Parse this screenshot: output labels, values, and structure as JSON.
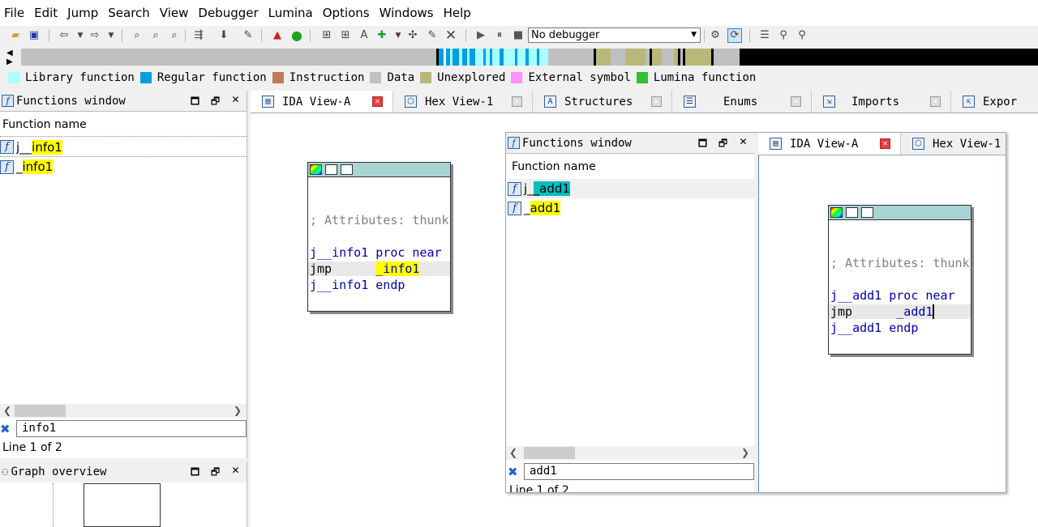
{
  "menu": [
    "File",
    "Edit",
    "Jump",
    "Search",
    "View",
    "Debugger",
    "Lumina",
    "Options",
    "Windows",
    "Help"
  ],
  "toolbar": {
    "debugger_select": "No debugger"
  },
  "legend": [
    {
      "label": "Library function",
      "color": "#aaffff"
    },
    {
      "label": "Regular function",
      "color": "#00a0e0"
    },
    {
      "label": "Instruction",
      "color": "#c07858"
    },
    {
      "label": "Data",
      "color": "#c0c0c0"
    },
    {
      "label": "Unexplored",
      "color": "#b8b878"
    },
    {
      "label": "External symbol",
      "color": "#ff90ff"
    },
    {
      "label": "Lumina function",
      "color": "#30c030"
    }
  ],
  "left_functions": {
    "title": "Functions window",
    "column": "Function name",
    "rows": [
      {
        "prefix": "j__",
        "hl": "info1"
      },
      {
        "prefix": "_",
        "hl": "info1"
      }
    ],
    "filter": "info1",
    "status": "Line 1 of 2"
  },
  "graph_overview": {
    "title": "Graph overview"
  },
  "tabs": [
    {
      "label": "IDA View-A",
      "icon": "ida-view-icon"
    },
    {
      "label": "Hex View-1",
      "icon": "hex-view-icon"
    },
    {
      "label": "Structures",
      "icon": "structures-icon"
    },
    {
      "label": "Enums",
      "icon": "enums-icon"
    },
    {
      "label": "Imports",
      "icon": "imports-icon"
    },
    {
      "label": "Expor",
      "icon": "exports-icon"
    }
  ],
  "node_main": {
    "comment": "; Attributes: thunk",
    "proc_name": "j__info1",
    "proc_kw": " proc near",
    "jmp": "jmp",
    "jmp_target": "_info1",
    "endp_name": "j__info1",
    "endp_kw": " endp"
  },
  "float_window": {
    "functions_title": "Functions window",
    "column": "Function name",
    "rows": [
      {
        "prefix": "j_",
        "hl": "_add1"
      },
      {
        "prefix": "_",
        "hl": "add1"
      }
    ],
    "filter": "add1",
    "status": "Line 1 of 2",
    "tabs": [
      {
        "label": "IDA View-A"
      },
      {
        "label": "Hex View-1"
      }
    ],
    "node": {
      "comment": "; Attributes: thunk",
      "proc_name": "j__add1",
      "proc_kw": " proc near",
      "jmp": "jmp",
      "jmp_target": "_add1",
      "endp_name": "j__add1",
      "endp_kw": " endp"
    }
  }
}
